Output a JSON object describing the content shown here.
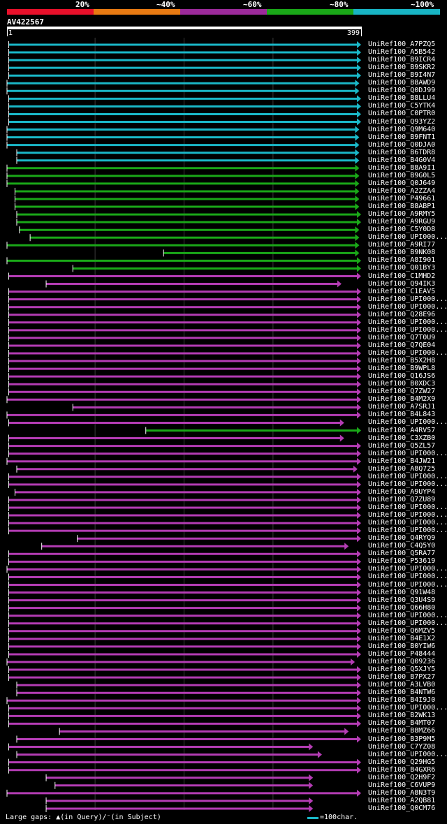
{
  "legend": {
    "segments": [
      {
        "label": "20%",
        "color": "#e8102a"
      },
      {
        "label": "~40%",
        "color": "#e87a12"
      },
      {
        "label": "~60%",
        "color": "#9c2a9a"
      },
      {
        "label": "~80%",
        "color": "#1aa818"
      },
      {
        "label": "~100%",
        "color": "#18b4c4"
      }
    ]
  },
  "query": {
    "name": "AV422567",
    "start": "1",
    "end": "399"
  },
  "footer": {
    "gaps_text": "Large gaps: ▲(in Query)/⁻(in Subject)",
    "scale_text": "=100char."
  },
  "colors": {
    "cyan": "#1ab8c8",
    "green": "#1aa818",
    "purple": "#b43cb4",
    "grid": "#3a3a3a"
  },
  "chart_data": {
    "type": "alignment",
    "query_length": 399,
    "hits": [
      {
        "name": "UniRef100_A7PZQ5",
        "identity": "~100%",
        "qs": 3,
        "qe": 399
      },
      {
        "name": "UniRef100_A5B542",
        "identity": "~100%",
        "qs": 3,
        "qe": 399
      },
      {
        "name": "UniRef100_B9ICR4",
        "identity": "~100%",
        "qs": 3,
        "qe": 399
      },
      {
        "name": "UniRef100_B9SKR2",
        "identity": "~100%",
        "qs": 3,
        "qe": 399
      },
      {
        "name": "UniRef100_B9I4N7",
        "identity": "~100%",
        "qs": 3,
        "qe": 399
      },
      {
        "name": "UniRef100_B8AWD9",
        "identity": "~100%",
        "qs": 1,
        "qe": 397
      },
      {
        "name": "UniRef100_Q0DJ99",
        "identity": "~100%",
        "qs": 1,
        "qe": 397
      },
      {
        "name": "UniRef100_B8LLU4",
        "identity": "~100%",
        "qs": 3,
        "qe": 399
      },
      {
        "name": "UniRef100_C5YTK4",
        "identity": "~100%",
        "qs": 3,
        "qe": 399
      },
      {
        "name": "UniRef100_C0PTR0",
        "identity": "~100%",
        "qs": 3,
        "qe": 399
      },
      {
        "name": "UniRef100_Q93YZ2",
        "identity": "~100%",
        "qs": 3,
        "qe": 399
      },
      {
        "name": "UniRef100_Q9M640",
        "identity": "~100%",
        "qs": 1,
        "qe": 397
      },
      {
        "name": "UniRef100_B9FNT1",
        "identity": "~100%",
        "qs": 1,
        "qe": 397
      },
      {
        "name": "UniRef100_Q0DJA0",
        "identity": "~100%",
        "qs": 1,
        "qe": 397
      },
      {
        "name": "UniRef100_B6TDR8",
        "identity": "~100%",
        "qs": 12,
        "qe": 397
      },
      {
        "name": "UniRef100_B4G0V4",
        "identity": "~100%",
        "qs": 12,
        "qe": 397
      },
      {
        "name": "UniRef100_B8A9I1",
        "identity": "~80%",
        "qs": 1,
        "qe": 397
      },
      {
        "name": "UniRef100_B9G0L5",
        "identity": "~80%",
        "qs": 1,
        "qe": 397
      },
      {
        "name": "UniRef100_Q0J649",
        "identity": "~80%",
        "qs": 1,
        "qe": 397
      },
      {
        "name": "UniRef100_A2ZZA4",
        "identity": "~80%",
        "qs": 10,
        "qe": 397
      },
      {
        "name": "UniRef100_P49661",
        "identity": "~80%",
        "qs": 10,
        "qe": 397
      },
      {
        "name": "UniRef100_B8ABP1",
        "identity": "~80%",
        "qs": 10,
        "qe": 397
      },
      {
        "name": "UniRef100_A9RMY5",
        "identity": "~80%",
        "qs": 12,
        "qe": 399
      },
      {
        "name": "UniRef100_A9RGU9",
        "identity": "~80%",
        "qs": 12,
        "qe": 399
      },
      {
        "name": "UniRef100_C5Y0D8",
        "identity": "~80%",
        "qs": 15,
        "qe": 397
      },
      {
        "name": "UniRef100_UPI000...",
        "identity": "~80%",
        "qs": 27,
        "qe": 397
      },
      {
        "name": "UniRef100_A9RI77",
        "identity": "~80%",
        "qs": 1,
        "qe": 397
      },
      {
        "name": "UniRef100_B9NK08",
        "identity": "~80%",
        "qs": 177,
        "qe": 397
      },
      {
        "name": "UniRef100_A8I901",
        "identity": "~80%",
        "qs": 1,
        "qe": 399
      },
      {
        "name": "UniRef100_Q01BY3",
        "identity": "~80%",
        "qs": 75,
        "qe": 399
      },
      {
        "name": "UniRef100_C1MHD2",
        "identity": "~60%",
        "qs": 3,
        "qe": 399
      },
      {
        "name": "UniRef100_Q94IK3",
        "identity": "~60%",
        "qs": 45,
        "qe": 377
      },
      {
        "name": "UniRef100_C1EAV5",
        "identity": "~60%",
        "qs": 3,
        "qe": 399
      },
      {
        "name": "UniRef100_UPI000...",
        "identity": "~60%",
        "qs": 3,
        "qe": 399
      },
      {
        "name": "UniRef100_UPI000...",
        "identity": "~60%",
        "qs": 3,
        "qe": 399
      },
      {
        "name": "UniRef100_Q28E96",
        "identity": "~60%",
        "qs": 3,
        "qe": 399
      },
      {
        "name": "UniRef100_UPI000...",
        "identity": "~60%",
        "qs": 3,
        "qe": 399
      },
      {
        "name": "UniRef100_UPI000...",
        "identity": "~60%",
        "qs": 3,
        "qe": 399
      },
      {
        "name": "UniRef100_Q7T0U9",
        "identity": "~60%",
        "qs": 3,
        "qe": 399
      },
      {
        "name": "UniRef100_Q7QE04",
        "identity": "~60%",
        "qs": 3,
        "qe": 399
      },
      {
        "name": "UniRef100_UPI000...",
        "identity": "~60%",
        "qs": 3,
        "qe": 399
      },
      {
        "name": "UniRef100_B5X2H8",
        "identity": "~60%",
        "qs": 3,
        "qe": 399
      },
      {
        "name": "UniRef100_B9WPL8",
        "identity": "~60%",
        "qs": 3,
        "qe": 399
      },
      {
        "name": "UniRef100_Q16JS6",
        "identity": "~60%",
        "qs": 3,
        "qe": 399
      },
      {
        "name": "UniRef100_B0XDC3",
        "identity": "~60%",
        "qs": 3,
        "qe": 399
      },
      {
        "name": "UniRef100_Q7ZW27",
        "identity": "~60%",
        "qs": 3,
        "qe": 399
      },
      {
        "name": "UniRef100_B4M2X9",
        "identity": "~60%",
        "qs": 1,
        "qe": 399
      },
      {
        "name": "UniRef100_A7SRJ1",
        "identity": "~60%",
        "qs": 75,
        "qe": 399
      },
      {
        "name": "UniRef100_B4L843",
        "identity": "~60%",
        "qs": 1,
        "qe": 399
      },
      {
        "name": "UniRef100_UPI000...",
        "identity": "~60%",
        "qs": 3,
        "qe": 380
      },
      {
        "name": "UniRef100_A4RV57",
        "identity": "~80%",
        "qs": 157,
        "qe": 399
      },
      {
        "name": "UniRef100_C3XZB0",
        "identity": "~60%",
        "qs": 3,
        "qe": 380
      },
      {
        "name": "UniRef100_Q5ZL57",
        "identity": "~60%",
        "qs": 3,
        "qe": 399
      },
      {
        "name": "UniRef100_UPI000...",
        "identity": "~60%",
        "qs": 3,
        "qe": 399
      },
      {
        "name": "UniRef100_B4JW21",
        "identity": "~60%",
        "qs": 1,
        "qe": 399
      },
      {
        "name": "UniRef100_A8Q725",
        "identity": "~60%",
        "qs": 12,
        "qe": 395
      },
      {
        "name": "UniRef100_UPI000...",
        "identity": "~60%",
        "qs": 3,
        "qe": 399
      },
      {
        "name": "UniRef100_UPI000...",
        "identity": "~60%",
        "qs": 3,
        "qe": 399
      },
      {
        "name": "UniRef100_A9UYP4",
        "identity": "~60%",
        "qs": 10,
        "qe": 399
      },
      {
        "name": "UniRef100_Q7ZU89",
        "identity": "~60%",
        "qs": 3,
        "qe": 399
      },
      {
        "name": "UniRef100_UPI000...",
        "identity": "~60%",
        "qs": 3,
        "qe": 399
      },
      {
        "name": "UniRef100_UPI000...",
        "identity": "~60%",
        "qs": 3,
        "qe": 399
      },
      {
        "name": "UniRef100_UPI000...",
        "identity": "~60%",
        "qs": 3,
        "qe": 399
      },
      {
        "name": "UniRef100_UPI000...",
        "identity": "~60%",
        "qs": 3,
        "qe": 399
      },
      {
        "name": "UniRef100_Q4RYQ9",
        "identity": "~60%",
        "qs": 80,
        "qe": 399
      },
      {
        "name": "UniRef100_C4Q5Y0",
        "identity": "~60%",
        "qs": 40,
        "qe": 385
      },
      {
        "name": "UniRef100_Q5RA77",
        "identity": "~60%",
        "qs": 3,
        "qe": 399
      },
      {
        "name": "UniRef100_P53619",
        "identity": "~60%",
        "qs": 3,
        "qe": 399
      },
      {
        "name": "UniRef100_UPI000...",
        "identity": "~60%",
        "qs": 1,
        "qe": 399
      },
      {
        "name": "UniRef100_UPI000...",
        "identity": "~60%",
        "qs": 3,
        "qe": 399
      },
      {
        "name": "UniRef100_UPI000...",
        "identity": "~60%",
        "qs": 3,
        "qe": 399
      },
      {
        "name": "UniRef100_Q91W48",
        "identity": "~60%",
        "qs": 3,
        "qe": 399
      },
      {
        "name": "UniRef100_Q3U4S9",
        "identity": "~60%",
        "qs": 3,
        "qe": 399
      },
      {
        "name": "UniRef100_Q66H80",
        "identity": "~60%",
        "qs": 3,
        "qe": 399
      },
      {
        "name": "UniRef100_UPI000...",
        "identity": "~60%",
        "qs": 3,
        "qe": 399
      },
      {
        "name": "UniRef100_UPI000...",
        "identity": "~60%",
        "qs": 3,
        "qe": 399
      },
      {
        "name": "UniRef100_Q6MZV5",
        "identity": "~60%",
        "qs": 3,
        "qe": 399
      },
      {
        "name": "UniRef100_B4E1X2",
        "identity": "~60%",
        "qs": 3,
        "qe": 399
      },
      {
        "name": "UniRef100_B0YIW6",
        "identity": "~60%",
        "qs": 3,
        "qe": 399
      },
      {
        "name": "UniRef100_P48444",
        "identity": "~60%",
        "qs": 3,
        "qe": 399
      },
      {
        "name": "UniRef100_Q09236",
        "identity": "~60%",
        "qs": 1,
        "qe": 392
      },
      {
        "name": "UniRef100_Q5XJY5",
        "identity": "~60%",
        "qs": 3,
        "qe": 399
      },
      {
        "name": "UniRef100_B7PX27",
        "identity": "~60%",
        "qs": 3,
        "qe": 399
      },
      {
        "name": "UniRef100_A3LVB0",
        "identity": "~60%",
        "qs": 12,
        "qe": 399
      },
      {
        "name": "UniRef100_B4NTW6",
        "identity": "~60%",
        "qs": 12,
        "qe": 399
      },
      {
        "name": "UniRef100_B4I9J0",
        "identity": "~60%",
        "qs": 1,
        "qe": 399
      },
      {
        "name": "UniRef100_UPI000...",
        "identity": "~60%",
        "qs": 3,
        "qe": 399
      },
      {
        "name": "UniRef100_B2WK13",
        "identity": "~60%",
        "qs": 3,
        "qe": 399
      },
      {
        "name": "UniRef100_B4MT07",
        "identity": "~60%",
        "qs": 3,
        "qe": 399
      },
      {
        "name": "UniRef100_B8MZ66",
        "identity": "~60%",
        "qs": 60,
        "qe": 385
      },
      {
        "name": "UniRef100_B3P9M5",
        "identity": "~60%",
        "qs": 12,
        "qe": 399
      },
      {
        "name": "UniRef100_C7YZ08",
        "identity": "~60%",
        "qs": 3,
        "qe": 345
      },
      {
        "name": "UniRef100_UPI000...",
        "identity": "~60%",
        "qs": 12,
        "qe": 355
      },
      {
        "name": "UniRef100_Q29HG5",
        "identity": "~60%",
        "qs": 3,
        "qe": 399
      },
      {
        "name": "UniRef100_B4GXR6",
        "identity": "~60%",
        "qs": 3,
        "qe": 399
      },
      {
        "name": "UniRef100_Q2H9F2",
        "identity": "~60%",
        "qs": 45,
        "qe": 345
      },
      {
        "name": "UniRef100_C6VUP9",
        "identity": "~60%",
        "qs": 55,
        "qe": 345
      },
      {
        "name": "UniRef100_A8N3T9",
        "identity": "~60%",
        "qs": 1,
        "qe": 399
      },
      {
        "name": "UniRef100_A2QB81",
        "identity": "~60%",
        "qs": 45,
        "qe": 345
      },
      {
        "name": "UniRef100_Q0CM76",
        "identity": "~60%",
        "qs": 45,
        "qe": 345
      }
    ]
  }
}
